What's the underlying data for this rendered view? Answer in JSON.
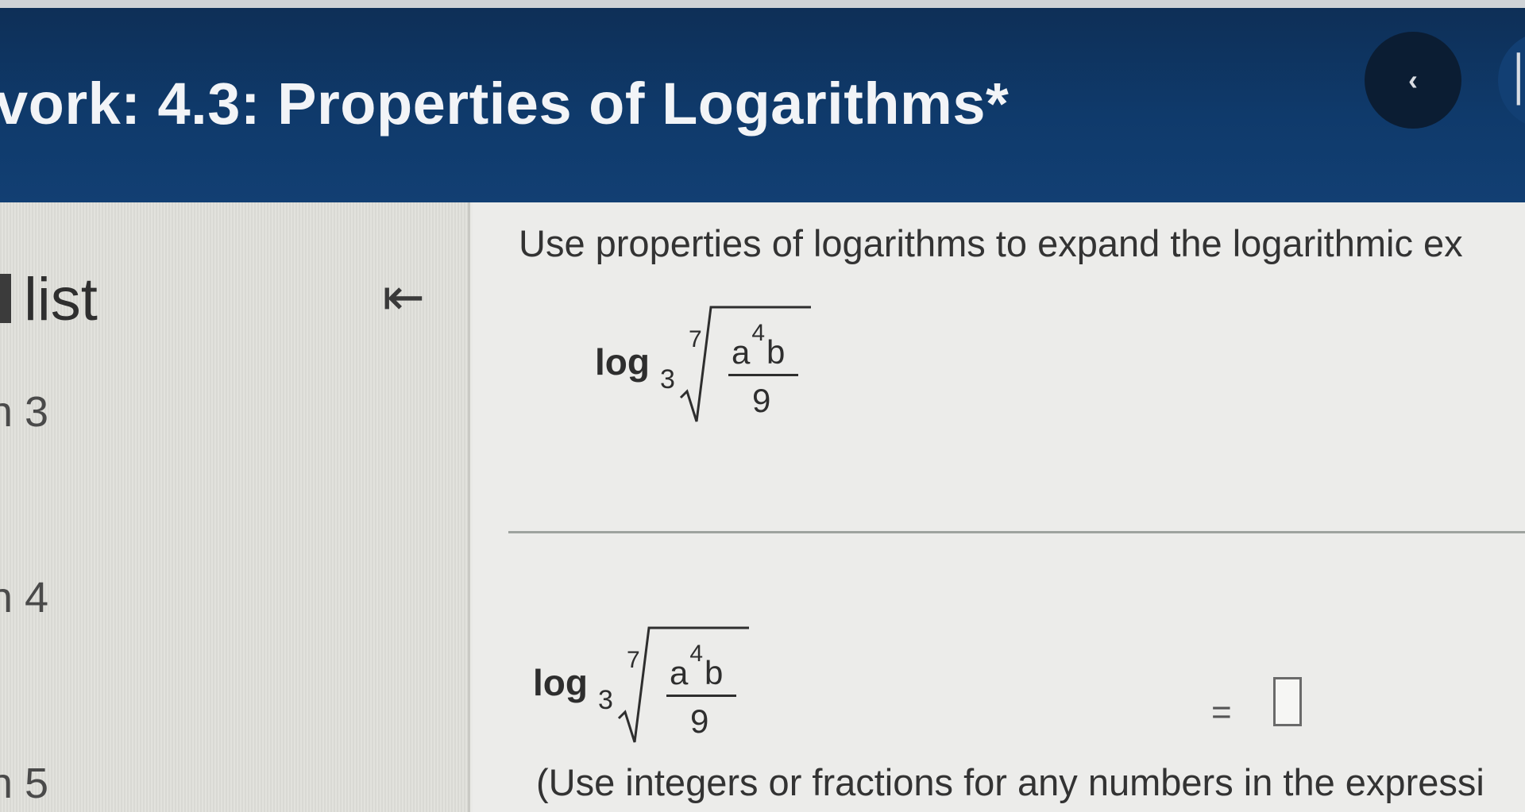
{
  "header": {
    "title": "vork:  4.3: Properties of Logarithms*",
    "prev_icon": "chevron-left-icon",
    "next_icon": "partial-icon"
  },
  "sidebar": {
    "title": "list",
    "collapse_icon": "collapse-left-icon",
    "collapse_label": "⇤",
    "items": [
      {
        "label": "n 3"
      },
      {
        "label": "n 4"
      },
      {
        "label": "n 5"
      }
    ]
  },
  "question": {
    "prompt": "Use properties of logarithms to expand the logarithmic ex",
    "expression": {
      "log": "log",
      "base": "3",
      "index": "7",
      "numerator_base": "a",
      "numerator_exp": "4",
      "numerator_rest": "b",
      "denominator": "9"
    },
    "equals": "=",
    "answer_value": "",
    "instructions": "(Use integers or fractions for any numbers in the expressi"
  },
  "colors": {
    "header_bg": "#0f3a6b",
    "nav_button_bg": "#0b1d33",
    "sidebar_bg": "#dedeD9",
    "main_bg": "#ececea"
  }
}
